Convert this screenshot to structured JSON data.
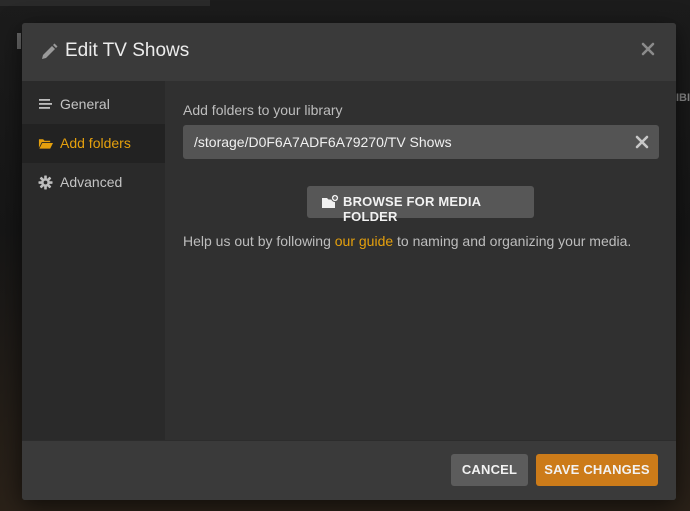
{
  "dialog": {
    "title": "Edit TV Shows",
    "close_icon": "close-icon",
    "header_icon": "pencil-icon"
  },
  "sidebar": {
    "items": [
      {
        "label": "General",
        "icon": "list-icon",
        "active": false
      },
      {
        "label": "Add folders",
        "icon": "folder-open-icon",
        "active": true
      },
      {
        "label": "Advanced",
        "icon": "gear-icon",
        "active": false
      }
    ]
  },
  "content": {
    "field_label": "Add folders to your library",
    "folder_path": "/storage/D0F6A7ADF6A79270/TV Shows",
    "browse_label": "BROWSE FOR MEDIA FOLDER",
    "help_prefix": "Help us out by following ",
    "help_link": "our guide",
    "help_suffix": " to naming and organizing your media."
  },
  "footer": {
    "cancel_label": "CANCEL",
    "save_label": "SAVE CHANGES"
  },
  "background": {
    "right_text": "IBI"
  },
  "colors": {
    "accent": "#e5a00d",
    "save_button": "#cc7b19",
    "dialog_bg": "#3a3a3a",
    "sidebar_bg": "#2a2a2a",
    "content_bg": "#303030"
  }
}
